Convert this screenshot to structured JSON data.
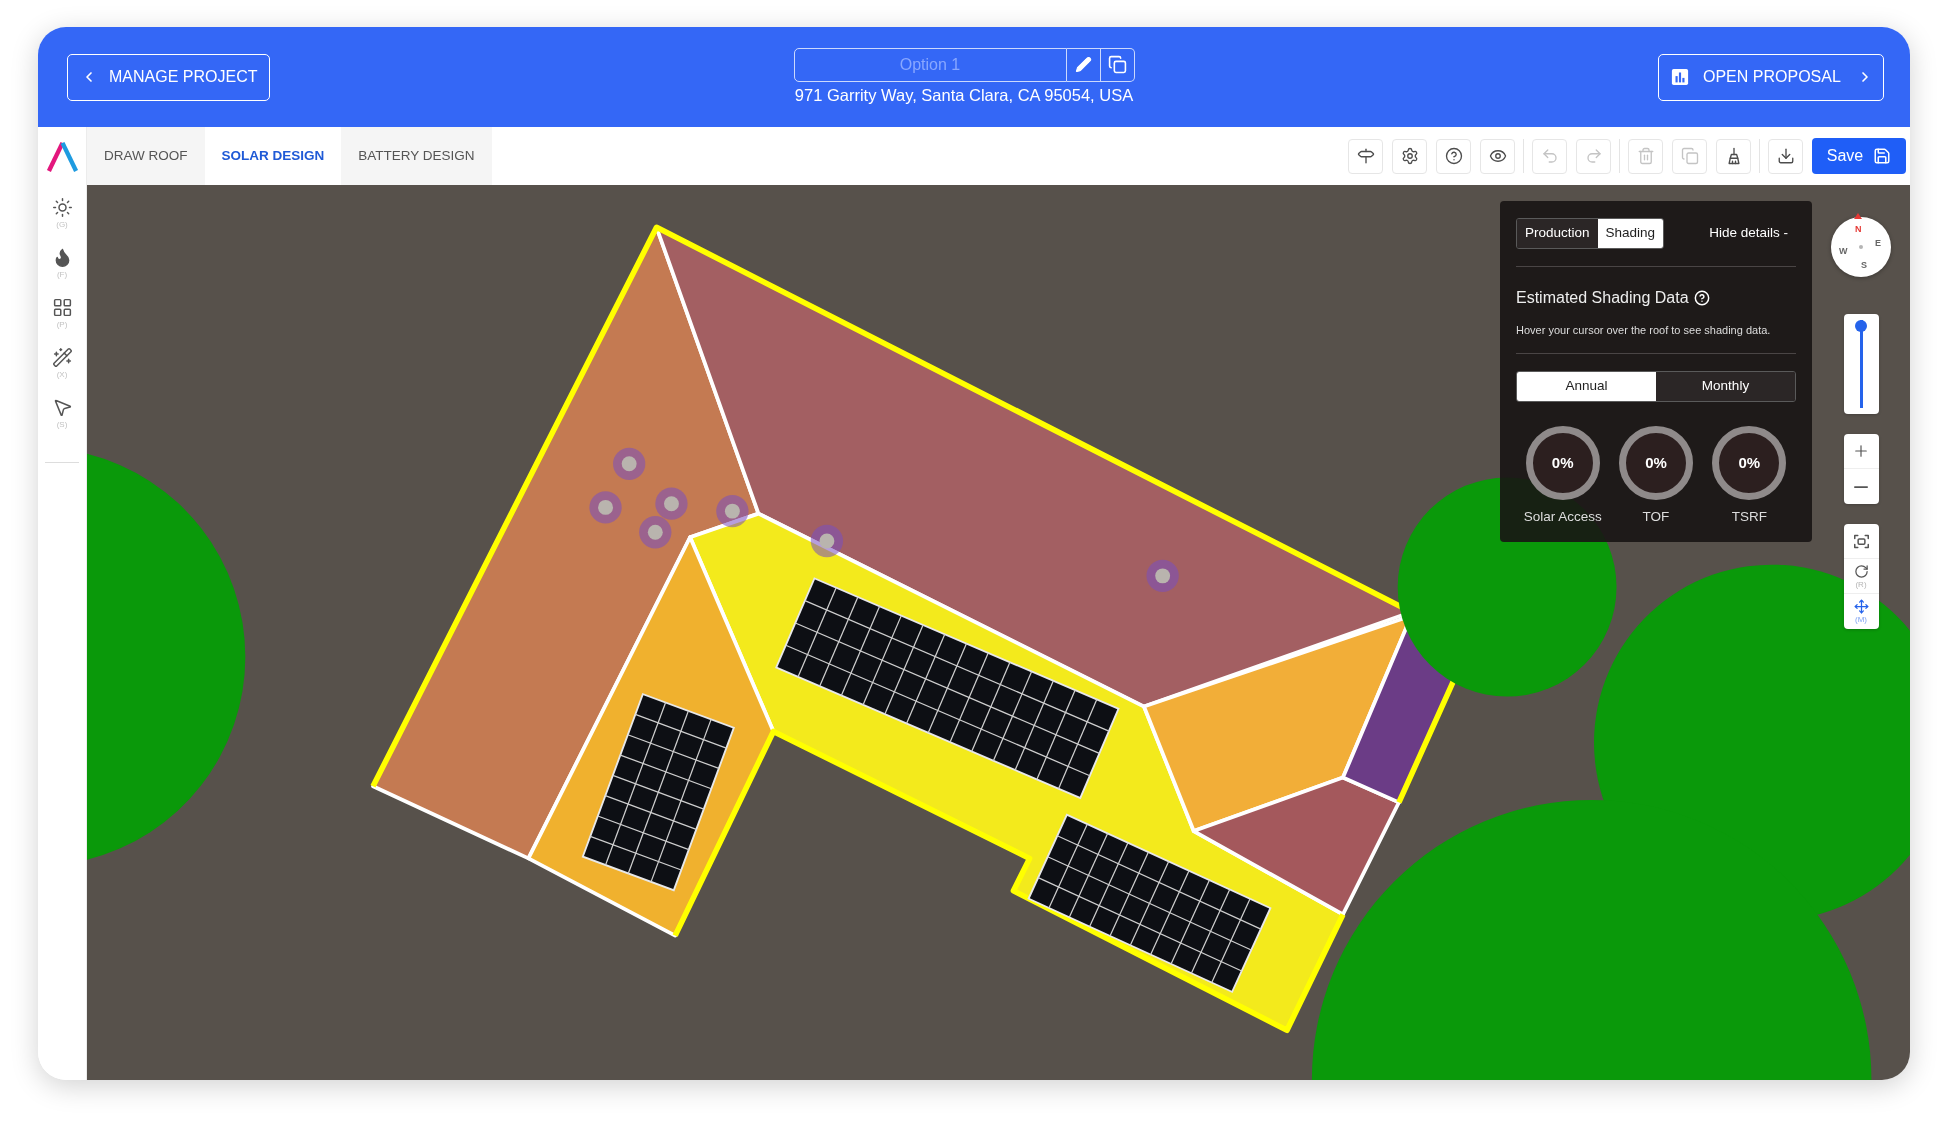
{
  "header": {
    "back_button": {
      "label": "MANAGE PROJECT"
    },
    "option_field": {
      "placeholder": "Option 1"
    },
    "address": "971 Garrity Way, Santa Clara, CA 95054, USA",
    "proposal_button": {
      "label": "OPEN PROPOSAL"
    }
  },
  "tabs": [
    {
      "label": "DRAW ROOF",
      "selected": false
    },
    {
      "label": "SOLAR DESIGN",
      "selected": true
    },
    {
      "label": "BATTERY DESIGN",
      "selected": false
    }
  ],
  "toolbar": {
    "groups": [
      {
        "items": [
          {
            "kind": "signpost",
            "disabled": false
          },
          {
            "kind": "settings",
            "disabled": false
          },
          {
            "kind": "help",
            "disabled": false
          },
          {
            "kind": "eye",
            "disabled": false
          }
        ]
      },
      {
        "items": [
          {
            "kind": "undo",
            "disabled": true
          },
          {
            "kind": "redo",
            "disabled": true
          }
        ]
      },
      {
        "items": [
          {
            "kind": "delete",
            "disabled": true
          },
          {
            "kind": "copy",
            "disabled": true
          },
          {
            "kind": "broom",
            "disabled": false
          }
        ]
      },
      {
        "items": [
          {
            "kind": "download",
            "disabled": false
          }
        ]
      }
    ],
    "save_button": {
      "label": "Save"
    }
  },
  "sidebar": {
    "tools": [
      {
        "kind": "sun",
        "hint": "(G)"
      },
      {
        "kind": "flame",
        "hint": "(F)"
      },
      {
        "kind": "grid",
        "hint": "(P)"
      },
      {
        "kind": "wand",
        "hint": "(X)"
      },
      {
        "kind": "pointer",
        "hint": "(S)"
      }
    ]
  },
  "shading_panel": {
    "view_tabs": [
      {
        "label": "Production",
        "selected": false
      },
      {
        "label": "Shading",
        "selected": true
      }
    ],
    "toggle_link": "Hide details -",
    "title": "Estimated Shading Data",
    "hint": "Hover your cursor over the roof to see shading data.",
    "period_tabs": [
      {
        "label": "Annual",
        "selected": true
      },
      {
        "label": "Monthly",
        "selected": false
      }
    ],
    "gauges": [
      {
        "value": "0%",
        "label": "Solar Access",
        "level": 0
      },
      {
        "value": "0%",
        "label": "TOF",
        "level": 0
      },
      {
        "value": "0%",
        "label": "TSRF",
        "level": 0
      }
    ]
  },
  "map_controls": {
    "compass": {
      "north": "N",
      "east": "E",
      "south": "S",
      "west": "W"
    },
    "zoom_slider": {
      "level": 1
    },
    "tools": [
      {
        "kind": "fit",
        "selected": false
      },
      {
        "kind": "rotate",
        "hint": "(R)",
        "selected": false
      },
      {
        "kind": "move",
        "hint": "(M)",
        "selected": true
      }
    ]
  }
}
